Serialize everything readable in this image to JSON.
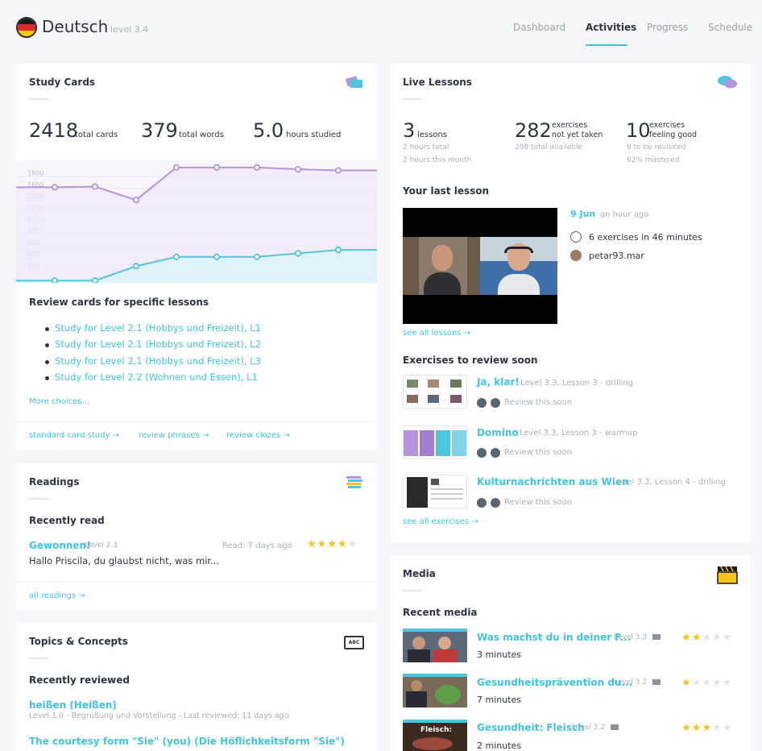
{
  "header": {
    "language": "Deutsch",
    "level": "level 3.4",
    "nav": [
      "Dashboard",
      "Activities",
      "Progress",
      "Schedule"
    ],
    "active_tab": "Activities"
  },
  "study_cards": {
    "title": "Study Cards",
    "stats": [
      {
        "value": "2418",
        "label": "total cards"
      },
      {
        "value": "379",
        "label": "total words"
      },
      {
        "value": "5.0",
        "label": "hours studied"
      }
    ],
    "chart_data": {
      "type": "line",
      "y_ticks": [
        "1800",
        "1600",
        "1400",
        "1200",
        "1000",
        "800",
        "600",
        "400",
        "200"
      ],
      "ylim": [
        0,
        1800
      ],
      "series": [
        {
          "values": [
            1620,
            1630,
            1400,
            1960,
            1960,
            1960,
            1930,
            1910,
            1910
          ],
          "color": "#b693dc"
        },
        {
          "values": [
            10,
            10,
            260,
            420,
            420,
            420,
            480,
            540,
            540
          ],
          "color": "#4ec6e2"
        }
      ]
    },
    "review_title": "Review cards for specific lessons",
    "lessons": [
      "Study for Level 2.1 (Hobbys und Freizeit), L1",
      "Study for Level 2.1 (Hobbys und Freizeit), L2",
      "Study for Level 2.1 (Hobbys und Freizeit), L3",
      "Study for Level 2.2 (Wohnen und Essen), L1"
    ],
    "more": "More choices...",
    "footer_links": [
      "standard card study →",
      "review phrases →",
      "review clozes →"
    ]
  },
  "readings": {
    "title": "Readings",
    "recent_title": "Recently read",
    "item_title": "Gewonnen!",
    "item_level": "Level 2.3",
    "item_read": "Read: 7 days ago",
    "item_rating": 4,
    "item_excerpt": "Hallo Priscila, du glaubst nicht, was mir...",
    "all_link": "all readings →"
  },
  "topics": {
    "title": "Topics & Concepts",
    "icon_text": "ABC",
    "recent_title": "Recently reviewed",
    "item1_title": "heißen (Heißen)",
    "item1_meta": "Level 1.0 - Begrüßung und Vorstellung - Last reviewed: 11 days ago",
    "item2_title": "The courtesy form \"Sie\" (you) (Die Höflichkeitsform \"Sie\")"
  },
  "live_lessons": {
    "title": "Live Lessons",
    "stats": [
      {
        "value": "3",
        "label": "lessons",
        "sub1": "2 hours total",
        "sub2": "2 hours this month"
      },
      {
        "value": "282",
        "label1": "exercises",
        "label2": "not yet taken",
        "sub1": "298 total available"
      },
      {
        "value": "10",
        "label1": "exercises",
        "label2": "feeling good",
        "sub1": "6 to be revisited",
        "sub2": "62% mastered"
      }
    ],
    "last_lesson_title": "Your last lesson",
    "date": "9 Jun",
    "ago": "an hour ago",
    "exercises_line": "6 exercises in 46 minutes",
    "teacher": "petar93.mar",
    "see_all": "see all lessons →",
    "review_title": "Exercises to review soon",
    "exercises": [
      {
        "title": "Ja, klar!",
        "meta": "Level 3.3, Lesson 3 - drilling",
        "status": "Review this soon"
      },
      {
        "title": "Domino",
        "meta": "Level 3.3, Lesson 3 - warmup",
        "status": "Review this soon"
      },
      {
        "title": "Kulturnachrichten aus Wien",
        "meta": "Level 3.3, Lesson 4 - drilling",
        "status": "Review this soon"
      }
    ],
    "see_all_ex": "see all exercises →"
  },
  "media": {
    "title": "Media",
    "recent_title": "Recent media",
    "items": [
      {
        "title": "Was machst du in deiner F...",
        "level": "Level 3.3",
        "duration": "3 minutes",
        "rating": 2
      },
      {
        "title": "Gesundheitsprävention du...",
        "level": "Level 3.2",
        "duration": "7 minutes",
        "rating": 1
      },
      {
        "title": "Gesundheit: Fleisch",
        "level": "Level 3.2",
        "duration": "2 minutes",
        "rating": 3
      }
    ],
    "thumb3_text": "Fleisch:"
  },
  "colors": {
    "accent": "#3ec5e3",
    "star": "#f5c518",
    "star_off": "#e1e4e8"
  }
}
